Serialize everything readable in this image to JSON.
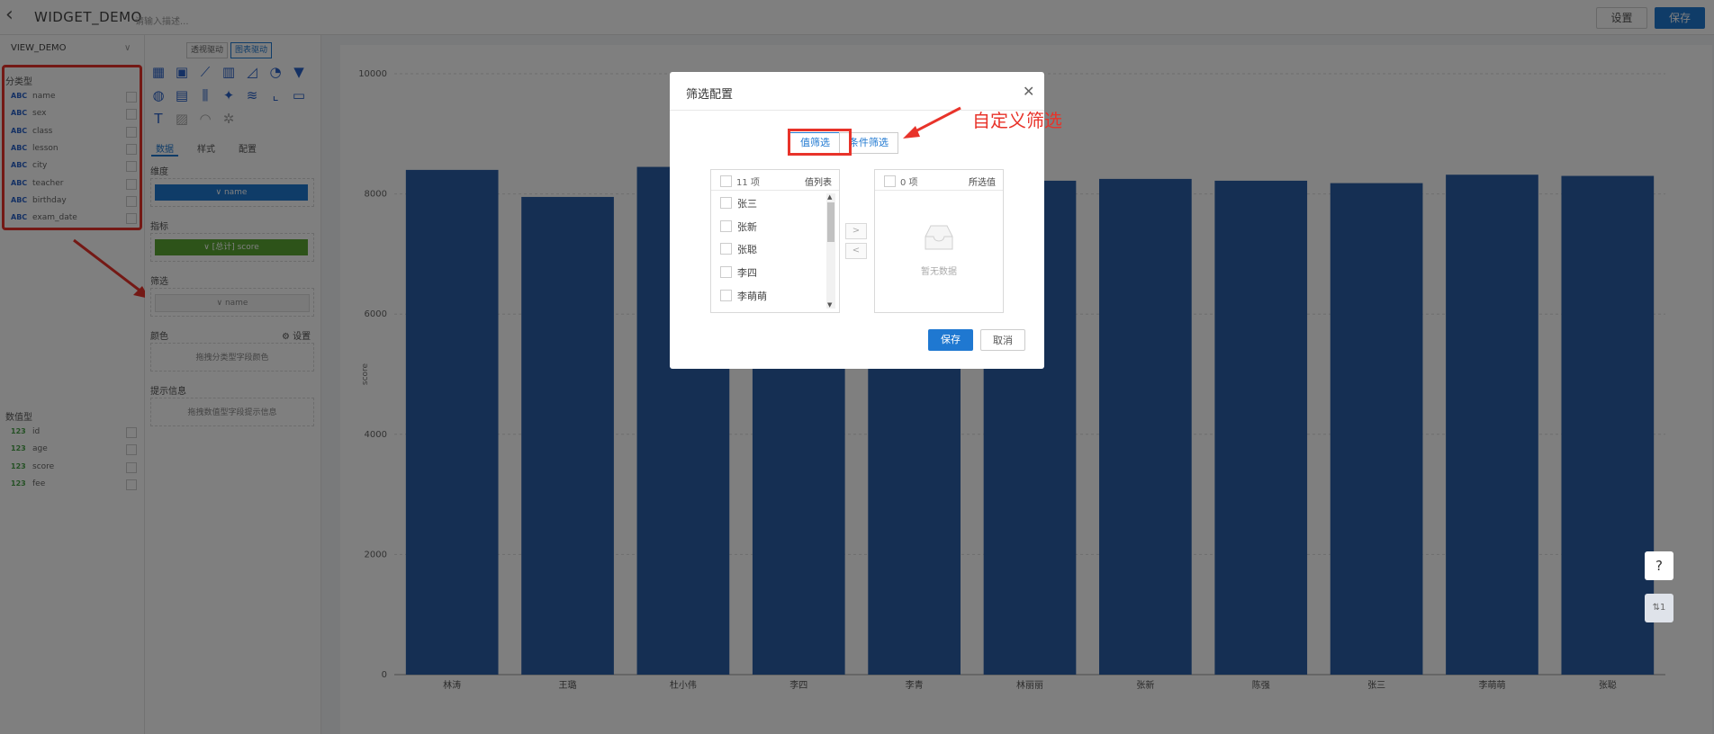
{
  "header": {
    "title": "WIDGET_DEMO",
    "description_placeholder": "请输入描述...",
    "settings_label": "设置",
    "save_label": "保存"
  },
  "left_panel": {
    "view_name": "VIEW_DEMO",
    "category_label": "分类型",
    "category_fields": [
      {
        "type": "ABC",
        "name": "name"
      },
      {
        "type": "ABC",
        "name": "sex"
      },
      {
        "type": "ABC",
        "name": "class"
      },
      {
        "type": "ABC",
        "name": "lesson"
      },
      {
        "type": "ABC",
        "name": "city"
      },
      {
        "type": "ABC",
        "name": "teacher"
      },
      {
        "type": "ABC",
        "name": "birthday"
      },
      {
        "type": "ABC",
        "name": "exam_date"
      }
    ],
    "numeric_label": "数值型",
    "numeric_fields": [
      {
        "type": "123",
        "name": "id"
      },
      {
        "type": "123",
        "name": "age"
      },
      {
        "type": "123",
        "name": "score"
      },
      {
        "type": "123",
        "name": "fee"
      }
    ]
  },
  "mid_panel": {
    "mode_buttons": [
      "透视驱动",
      "图表驱动"
    ],
    "tabs": [
      "数据",
      "样式",
      "配置"
    ],
    "dimension_label": "维度",
    "dimension_value": "∨ name",
    "metric_label": "指标",
    "metric_value": "∨ [总计] score",
    "filter_label": "筛选",
    "filter_value": "∨ name",
    "color_label": "颜色",
    "color_settings": "设置",
    "color_hint": "拖拽分类型字段颜色",
    "tooltip_label": "提示信息",
    "tooltip_hint": "拖拽数值型字段提示信息"
  },
  "chart_data": {
    "type": "bar",
    "categories": [
      "林涛",
      "王璐",
      "杜小伟",
      "李四",
      "李青",
      "林丽丽",
      "张新",
      "陈强",
      "张三",
      "李萌萌",
      "张聪"
    ],
    "values": [
      8400,
      7950,
      8450,
      8350,
      8300,
      8220,
      8250,
      8220,
      8180,
      8320,
      8300
    ],
    "ylabel": "score",
    "ylim": [
      0,
      10000
    ],
    "yticks": [
      0,
      2000,
      4000,
      6000,
      8000,
      10000
    ],
    "bar_color": "#2b5ea7",
    "grid": true
  },
  "modal": {
    "title": "筛选配置",
    "tab_value": "值筛选",
    "tab_condition": "条件筛选",
    "left_count": "11 项",
    "left_title": "值列表",
    "items": [
      "张三",
      "张新",
      "张聪",
      "李四",
      "李萌萌"
    ],
    "right_count": "0 项",
    "right_title": "所选值",
    "empty_text": "暂无数据",
    "save_label": "保存",
    "cancel_label": "取消"
  },
  "annotation": {
    "text": "自定义筛选",
    "color": "#e8332a"
  },
  "floating": {
    "help": "?",
    "sort": "⇅1"
  }
}
